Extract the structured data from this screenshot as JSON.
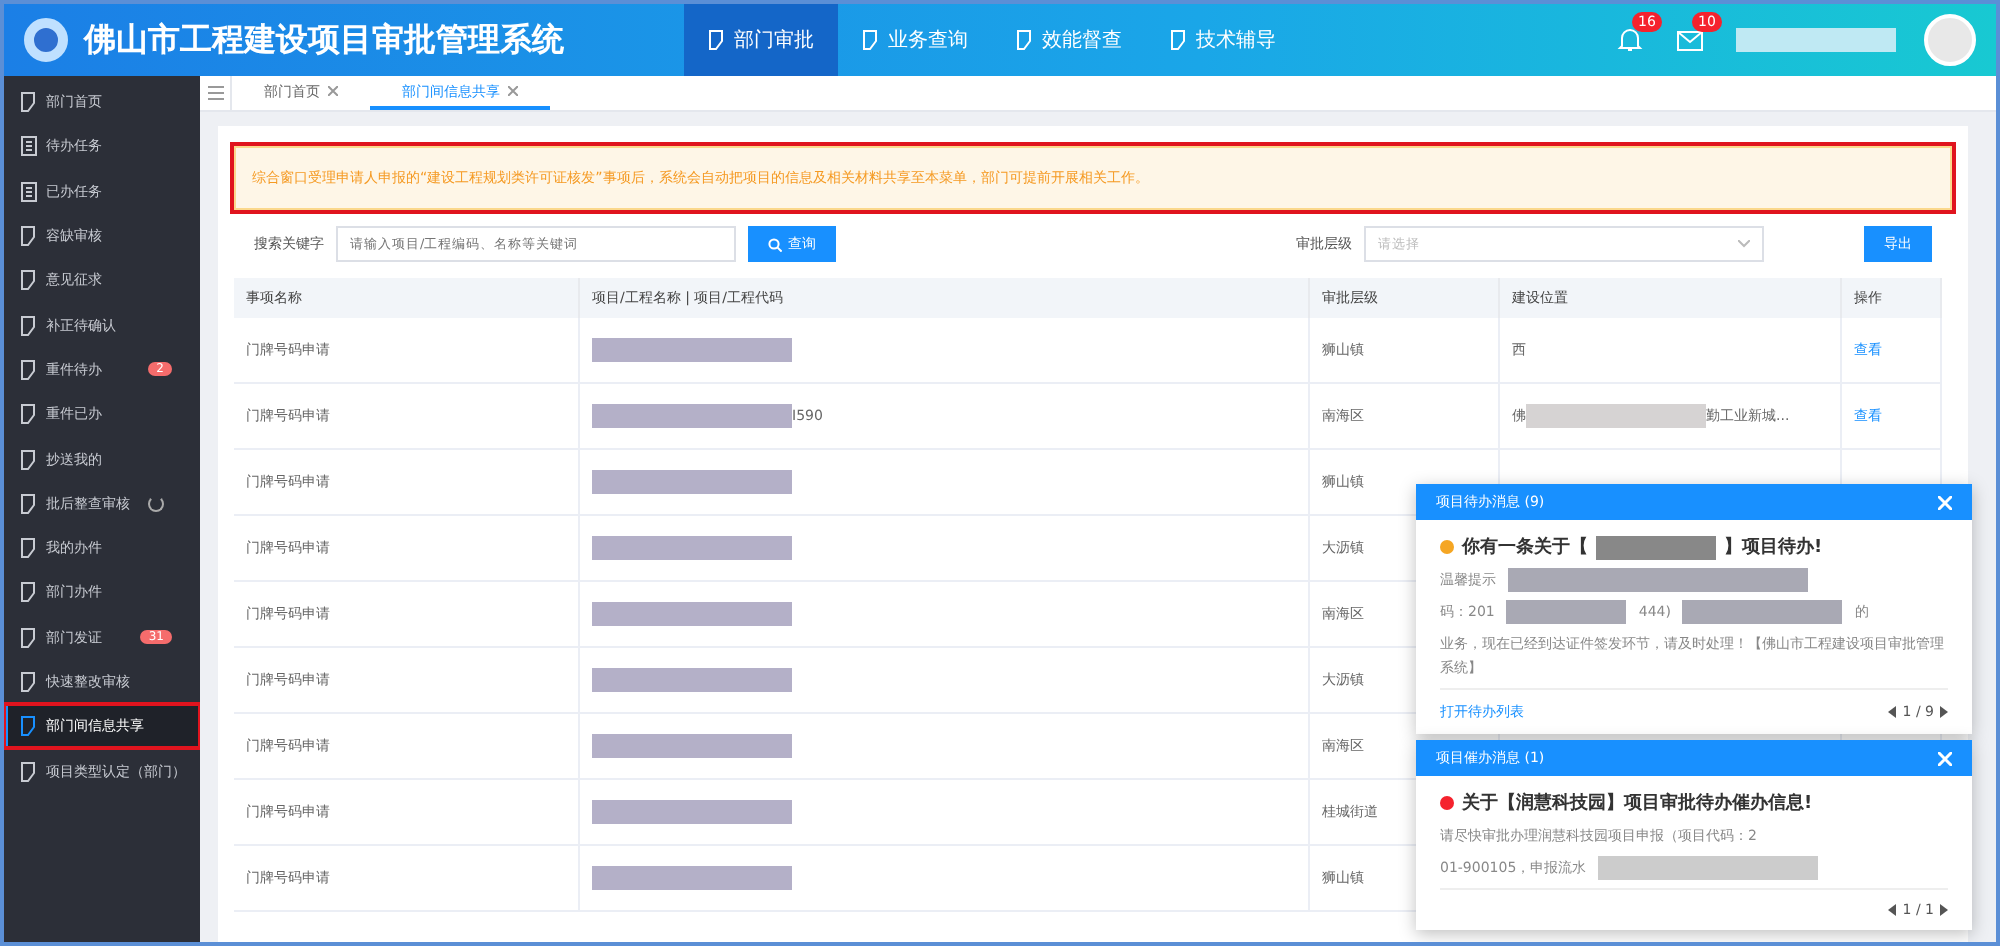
{
  "header": {
    "title": "佛山市工程建设项目审批管理系统",
    "nav": [
      {
        "label": "部门审批",
        "selected": true
      },
      {
        "label": "业务查询",
        "selected": false
      },
      {
        "label": "效能督查",
        "selected": false
      },
      {
        "label": "技术辅导",
        "selected": false
      }
    ],
    "bell_count": "16",
    "mail_count": "10"
  },
  "sidebar": {
    "items": [
      {
        "label": "部门首页",
        "kind": "doc",
        "selected": false
      },
      {
        "label": "待办任务",
        "kind": "list",
        "selected": false
      },
      {
        "label": "已办任务",
        "kind": "list",
        "selected": false
      },
      {
        "label": "容缺审核",
        "kind": "doc",
        "selected": false
      },
      {
        "label": "意见征求",
        "kind": "doc",
        "selected": false
      },
      {
        "label": "补正待确认",
        "kind": "doc",
        "selected": false
      },
      {
        "label": "重件待办",
        "kind": "doc",
        "selected": false,
        "badge": "2"
      },
      {
        "label": "重件已办",
        "kind": "doc",
        "selected": false
      },
      {
        "label": "抄送我的",
        "kind": "doc",
        "selected": false
      },
      {
        "label": "批后整查审核",
        "kind": "doc",
        "selected": false,
        "loading": true
      },
      {
        "label": "我的办件",
        "kind": "doc",
        "selected": false
      },
      {
        "label": "部门办件",
        "kind": "doc",
        "selected": false
      },
      {
        "label": "部门发证",
        "kind": "doc",
        "selected": false,
        "badge": "31"
      },
      {
        "label": "快速整改审核",
        "kind": "doc",
        "selected": false
      },
      {
        "label": "部门间信息共享",
        "kind": "doc",
        "selected": true,
        "highlighted": true
      },
      {
        "label": "项目类型认定（部门）",
        "kind": "doc",
        "selected": false
      }
    ]
  },
  "tabs": [
    {
      "label": "部门首页",
      "selected": false
    },
    {
      "label": "部门间信息共享",
      "selected": true
    }
  ],
  "notice": {
    "text": "综合窗口受理申请人申报的“建设工程规划类许可证核发”事项后，系统会自动把项目的信息及相关材料共享至本菜单，部门可提前开展相关工作。",
    "highlighted": true
  },
  "search": {
    "label": "搜索关键字",
    "placeholder": "请输入项目/工程编码、名称等关键词",
    "button": "查询",
    "level_label": "审批层级",
    "level_placeholder": "请选择",
    "export_button": "导出"
  },
  "table": {
    "columns": [
      "事项名称",
      "项目/工程名称 | 项目/工程代码",
      "审批层级",
      "建设位置",
      "操作"
    ],
    "rows": [
      {
        "item": "门牌号码申请",
        "level": "狮山镇",
        "location": [
          "西"
        ],
        "action": "查看"
      },
      {
        "item": "门牌号码申请",
        "code_fragment": "I590",
        "level": "南海区",
        "location": [
          "佛",
          "勤工业新城..."
        ],
        "action": "查看"
      },
      {
        "item": "门牌号码申请",
        "level": "狮山镇"
      },
      {
        "item": "门牌号码申请",
        "level": "大沥镇"
      },
      {
        "item": "门牌号码申请",
        "level": "南海区"
      },
      {
        "item": "门牌号码申请",
        "level": "大沥镇"
      },
      {
        "item": "门牌号码申请",
        "level": "南海区"
      },
      {
        "item": "门牌号码申请",
        "level": "桂城街道"
      },
      {
        "item": "门牌号码申请",
        "level": "狮山镇"
      }
    ]
  },
  "popups": [
    {
      "title": "项目待办消息 (9)",
      "color": "#f5a623",
      "heading_start": "你有一条关于【",
      "heading_end": "】项目待办!",
      "body": [
        "温馨提示",
        "码：201",
        "444)",
        "的",
        "业务，现在已经到达证件签发环节，请及时处理！【佛山市工程建设项目审批管理系统】"
      ],
      "link": "打开待办列表",
      "pager": "1 / 9"
    },
    {
      "title": "项目催办消息 (1)",
      "color": "#f5222d",
      "heading_start": "关于【润慧科技园】项目审批待办催办信息!",
      "body": [
        "请尽快审批办理润慧科技园项目申报（项目代码：2",
        "01-900105，申报流水"
      ],
      "pager": "1 / 1"
    }
  ]
}
